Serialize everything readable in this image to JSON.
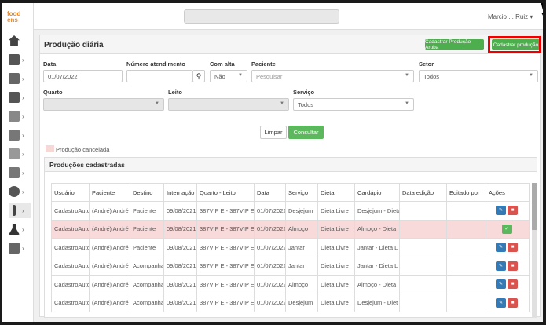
{
  "app": {
    "logo_line1": "food",
    "logo_line2": "ens"
  },
  "topbar": {
    "user_label": "Marcio ... Ruiz ▾"
  },
  "panel": {
    "title": "Produção diária",
    "btn_aruba": "Cadastrar Produção Aruba",
    "btn_cadastrar": "Cadastrar produção"
  },
  "filters": {
    "data_label": "Data",
    "data_value": "01/07/2022",
    "numero_label": "Número atendimento",
    "numero_value": "",
    "alta_label": "Com alta",
    "alta_value": "Não",
    "paciente_label": "Paciente",
    "paciente_placeholder": "Pesquisar",
    "setor_label": "Setor",
    "setor_value": "Todos",
    "quarto_label": "Quarto",
    "leito_label": "Leito",
    "servico_label": "Serviço",
    "servico_value": "Todos"
  },
  "actions": {
    "limpar": "Limpar",
    "consultar": "Consultar"
  },
  "legend": {
    "cancelada": "Produção cancelada"
  },
  "table": {
    "title": "Produções cadastradas",
    "headers": [
      "Usuário",
      "Paciente",
      "Destino",
      "Internação",
      "Quarto - Leito",
      "Data",
      "Serviço",
      "Dieta",
      "Cardápio",
      "Data edição",
      "Editado por",
      "Ações"
    ],
    "rows": [
      {
        "usuario": "CadastroAuto",
        "paciente": "(André) André E",
        "destino": "Paciente",
        "internacao": "09/08/2021",
        "quarto": "387VIP E - 387VIP E",
        "data": "01/07/2022",
        "servico": "Desjejum",
        "dieta": "Dieta Livre",
        "cardapio": "Desjejum - Dieta",
        "data_edicao": "",
        "editado_por": "",
        "cancelled": false
      },
      {
        "usuario": "CadastroAuto",
        "paciente": "(André) André E",
        "destino": "Paciente",
        "internacao": "09/08/2021",
        "quarto": "387VIP E - 387VIP E",
        "data": "01/07/2022",
        "servico": "Almoço",
        "dieta": "Dieta Livre",
        "cardapio": "Almoço - Dieta",
        "data_edicao": "",
        "editado_por": "",
        "cancelled": true
      },
      {
        "usuario": "CadastroAuto",
        "paciente": "(André) André E",
        "destino": "Paciente",
        "internacao": "09/08/2021",
        "quarto": "387VIP E - 387VIP E",
        "data": "01/07/2022",
        "servico": "Jantar",
        "dieta": "Dieta Livre",
        "cardapio": "Jantar - Dieta L",
        "data_edicao": "",
        "editado_por": "",
        "cancelled": false
      },
      {
        "usuario": "CadastroAuto",
        "paciente": "(André) André E",
        "destino": "Acompanha",
        "internacao": "09/08/2021",
        "quarto": "387VIP E - 387VIP E",
        "data": "01/07/2022",
        "servico": "Jantar",
        "dieta": "Dieta Livre",
        "cardapio": "Jantar - Dieta L",
        "data_edicao": "",
        "editado_por": "",
        "cancelled": false
      },
      {
        "usuario": "CadastroAuto",
        "paciente": "(André) André E",
        "destino": "Acompanha",
        "internacao": "09/08/2021",
        "quarto": "387VIP E - 387VIP E",
        "data": "01/07/2022",
        "servico": "Almoço",
        "dieta": "Dieta Livre",
        "cardapio": "Almoço - Dieta",
        "data_edicao": "",
        "editado_por": "",
        "cancelled": false
      },
      {
        "usuario": "CadastroAuto",
        "paciente": "(André) André E",
        "destino": "Acompanha",
        "internacao": "09/08/2021",
        "quarto": "387VIP E - 387VIP E",
        "data": "01/07/2022",
        "servico": "Desjejum",
        "dieta": "Dieta Livre",
        "cardapio": "Desjejum - Diet",
        "data_edicao": "",
        "editado_por": "",
        "cancelled": false
      }
    ]
  },
  "colors": {
    "accent_green": "#5cb85c",
    "highlight_red": "#e00000",
    "edit_blue": "#337ab7",
    "delete_red": "#d9534f",
    "cancelled_row": "#f8dada"
  },
  "icons": [
    "home-icon",
    "grid-icon",
    "building-icon",
    "factory-icon",
    "document-icon",
    "clipboard-icon",
    "login-icon",
    "list-icon",
    "group-icon",
    "spoon-icon",
    "flask-icon",
    "city-icon",
    "search-icon",
    "edit-icon",
    "trash-icon",
    "check-icon"
  ]
}
